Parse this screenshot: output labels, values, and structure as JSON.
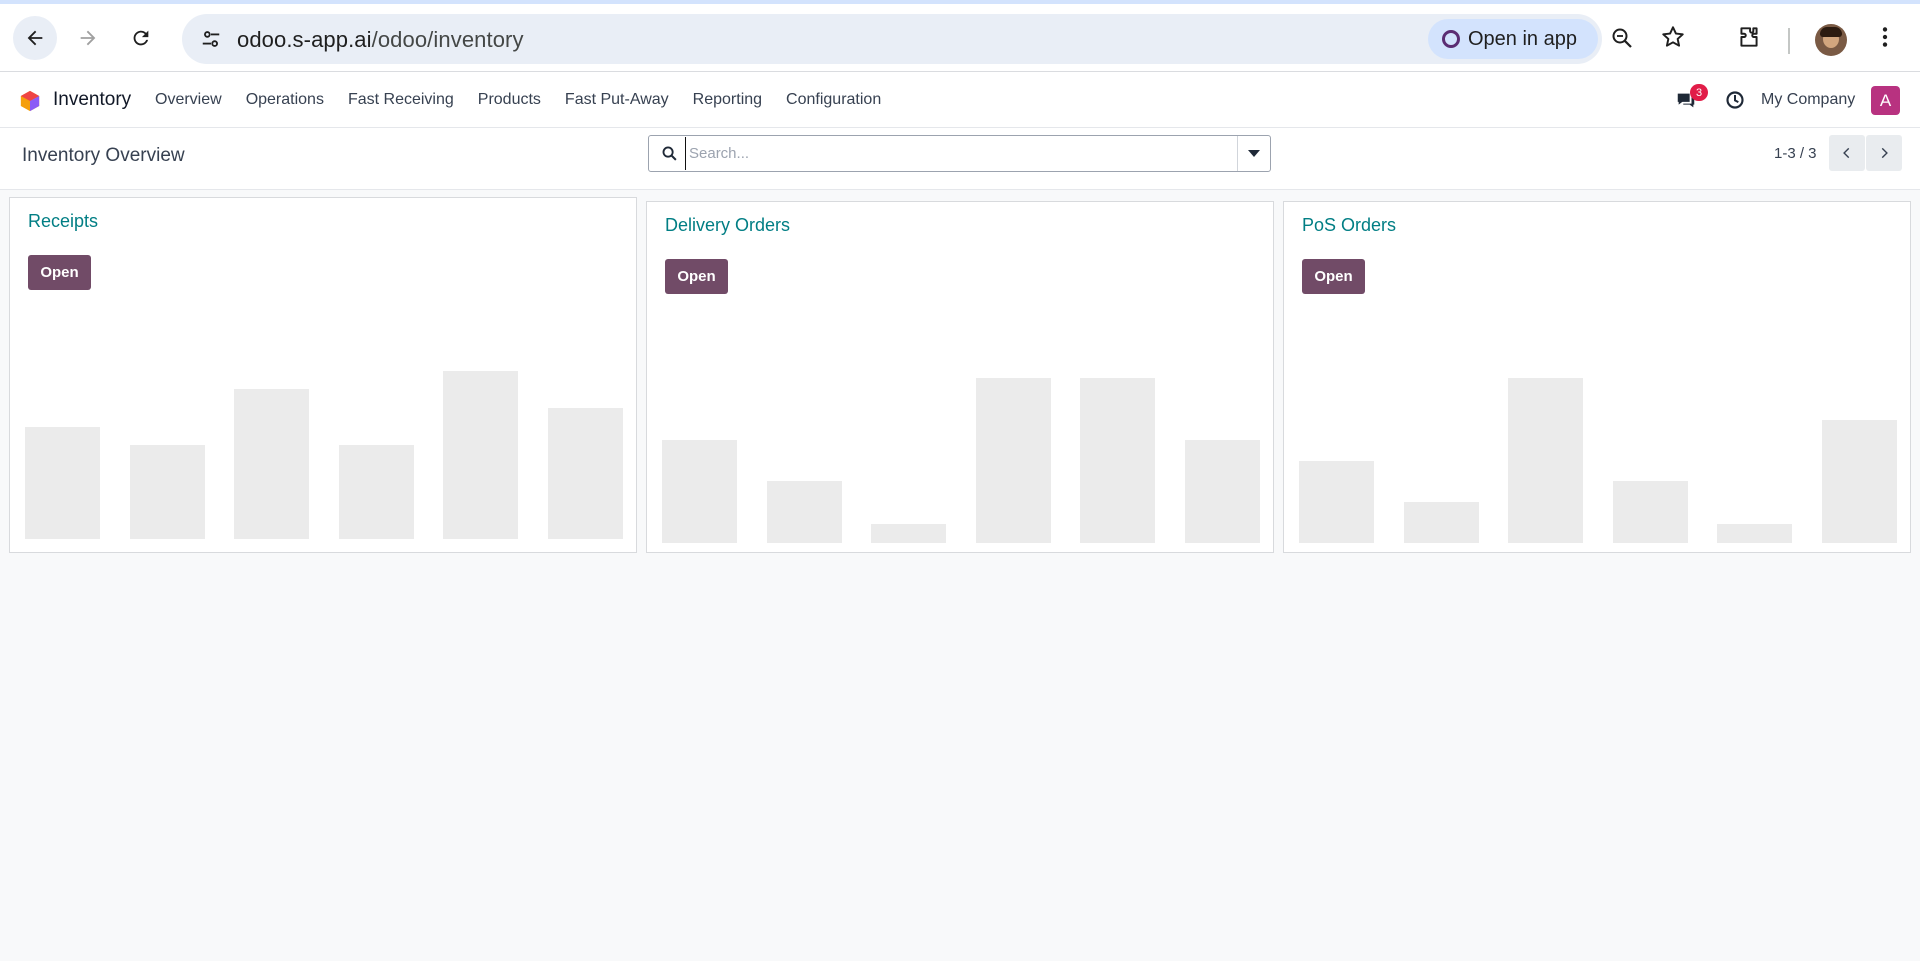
{
  "browser": {
    "url_host": "odoo.s-app.ai",
    "url_path": "/odoo/inventory",
    "open_in_app_label": "Open in app"
  },
  "navbar": {
    "app_name": "Inventory",
    "menu": [
      "Overview",
      "Operations",
      "Fast Receiving",
      "Products",
      "Fast Put-Away",
      "Reporting",
      "Configuration"
    ],
    "chat_badge": "3",
    "company": "My Company",
    "user_initial": "A"
  },
  "control": {
    "title": "Inventory Overview",
    "search_placeholder": "Search...",
    "pager": "1-3 / 3"
  },
  "cards": [
    {
      "title": "Receipts",
      "button": "Open",
      "bars": [
        0.6,
        0.5,
        0.8,
        0.5,
        0.9,
        0.7
      ]
    },
    {
      "title": "Delivery Orders",
      "button": "Open",
      "bars": [
        0.55,
        0.33,
        0.1,
        0.88,
        0.88,
        0.55
      ]
    },
    {
      "title": "PoS Orders",
      "button": "Open",
      "bars": [
        0.44,
        0.22,
        0.88,
        0.33,
        0.1,
        0.66
      ]
    }
  ],
  "colors": {
    "brand": "#714b67",
    "accent": "#017e84",
    "bar": "#ebebeb"
  }
}
